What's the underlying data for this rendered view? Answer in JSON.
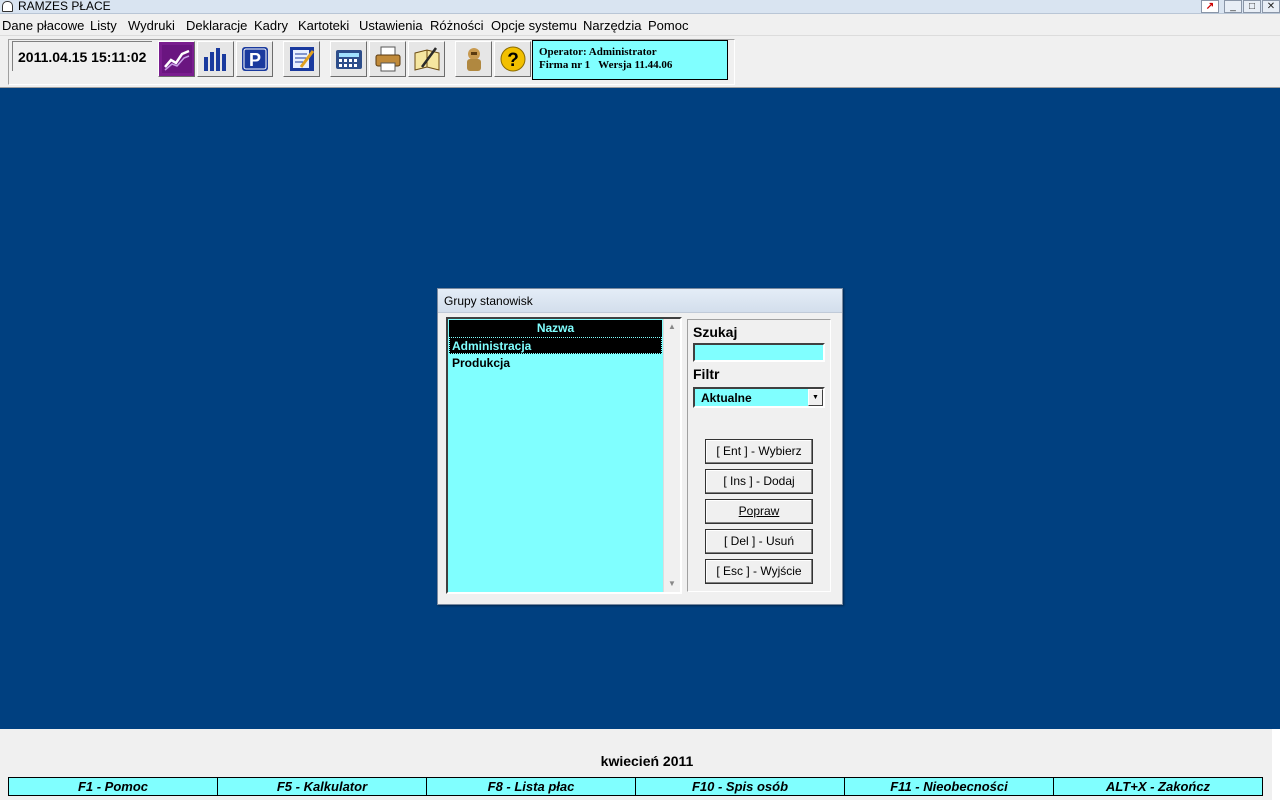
{
  "window": {
    "title": "RAMZES PŁACE"
  },
  "menu": [
    "Dane płacowe",
    "Listy",
    "Wydruki",
    "Deklaracje",
    "Kadry",
    "Kartoteki",
    "Ustawienia",
    "Różności",
    "Opcje systemu",
    "Narzędzia",
    "Pomoc"
  ],
  "toolbar": {
    "datetime": "2011.04.15 15:11:02",
    "operator_line": "Operator: Administrator",
    "firm_line": "Firma nr 1   Wersja 11.44.06",
    "icons": [
      "trend-chart-icon",
      "bar-chart-icon",
      "parking-p-icon",
      "edit-form-icon",
      "calculator-icon",
      "printer-icon",
      "book-pencil-icon",
      "astronaut-icon",
      "help-question-icon"
    ]
  },
  "dialog": {
    "title": "Grupy stanowisk",
    "list": {
      "header": "Nazwa",
      "rows": [
        "Administracja",
        "Produkcja"
      ],
      "selected_index": 0
    },
    "search": {
      "label": "Szukaj",
      "value": ""
    },
    "filter": {
      "label": "Filtr",
      "value": "Aktualne"
    },
    "buttons": [
      "[ Ent ] - Wybierz",
      "[ Ins ] - Dodaj",
      "Popraw",
      "[ Del ] - Usuń",
      "[ Esc ] - Wyjście"
    ]
  },
  "status": {
    "month": "kwiecień 2011",
    "fkeys": [
      "F1 - Pomoc",
      "F5 - Kalkulator",
      "F8 - Lista płac",
      "F10 - Spis osób",
      "F11 - Nieobecności",
      "ALT+X - Zakończ"
    ]
  },
  "colors": {
    "desktop": "#004080",
    "cyan": "#80ffff"
  }
}
